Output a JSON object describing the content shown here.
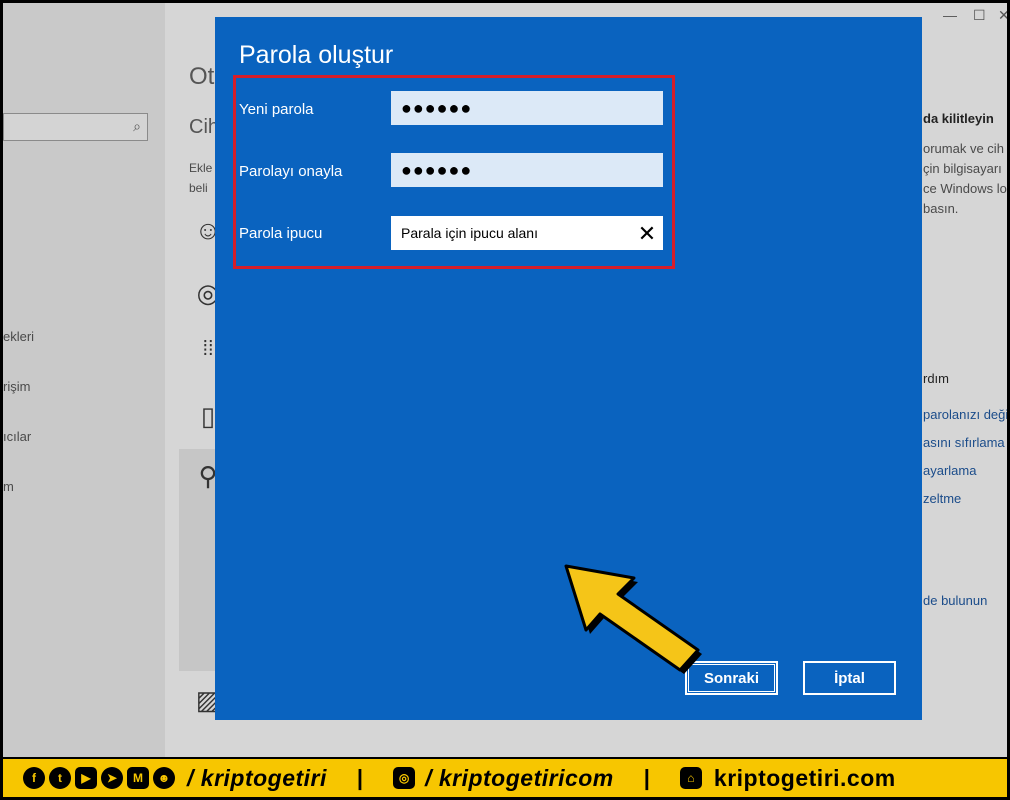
{
  "dialog": {
    "title": "Parola oluştur",
    "fields": [
      {
        "label": "Yeni parola",
        "value": "●●●●●●"
      },
      {
        "label": "Parolayı onayla",
        "value": "●●●●●●"
      },
      {
        "label": "Parola ipucu",
        "value": "Parala için ipucu alanı"
      }
    ],
    "next_label": "Sonraki",
    "cancel_label": "İptal"
  },
  "background": {
    "page_title": "Ot",
    "section_title": "Cih",
    "desc_line1": "Ekle",
    "desc_line2": "beli",
    "sidebar_items": [
      "ekleri",
      "rişim",
      "ıcılar",
      "m"
    ],
    "right_heading": "da kilitleyin",
    "right_desc": [
      "orumak ve cih",
      "çin bilgisayarı",
      "ce Windows lo",
      "basın."
    ],
    "right_section": "rdım",
    "right_links": [
      "parolanızı deği",
      "asını sıfırlama",
      "ayarlama",
      "zeltme"
    ],
    "bottom_link": "de bulunun"
  },
  "banner": {
    "handle1": "/ kriptogetiri",
    "handle2": "/ kriptogetiricom",
    "site": "kriptogetiri.com",
    "separator": "|"
  },
  "colors": {
    "dialog_bg": "#0a63bf",
    "highlight": "#d61e2a",
    "banner_bg": "#f7c600",
    "arrow": "#f5c518"
  }
}
